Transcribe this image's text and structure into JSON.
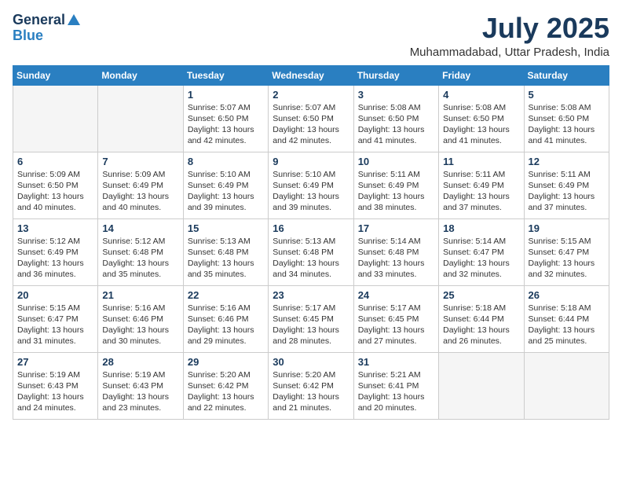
{
  "header": {
    "logo_general": "General",
    "logo_blue": "Blue",
    "month_year": "July 2025",
    "location": "Muhammadabad, Uttar Pradesh, India"
  },
  "days_of_week": [
    "Sunday",
    "Monday",
    "Tuesday",
    "Wednesday",
    "Thursday",
    "Friday",
    "Saturday"
  ],
  "weeks": [
    [
      {
        "day": "",
        "info": ""
      },
      {
        "day": "",
        "info": ""
      },
      {
        "day": "1",
        "info": "Sunrise: 5:07 AM\nSunset: 6:50 PM\nDaylight: 13 hours\nand 42 minutes."
      },
      {
        "day": "2",
        "info": "Sunrise: 5:07 AM\nSunset: 6:50 PM\nDaylight: 13 hours\nand 42 minutes."
      },
      {
        "day": "3",
        "info": "Sunrise: 5:08 AM\nSunset: 6:50 PM\nDaylight: 13 hours\nand 41 minutes."
      },
      {
        "day": "4",
        "info": "Sunrise: 5:08 AM\nSunset: 6:50 PM\nDaylight: 13 hours\nand 41 minutes."
      },
      {
        "day": "5",
        "info": "Sunrise: 5:08 AM\nSunset: 6:50 PM\nDaylight: 13 hours\nand 41 minutes."
      }
    ],
    [
      {
        "day": "6",
        "info": "Sunrise: 5:09 AM\nSunset: 6:50 PM\nDaylight: 13 hours\nand 40 minutes."
      },
      {
        "day": "7",
        "info": "Sunrise: 5:09 AM\nSunset: 6:49 PM\nDaylight: 13 hours\nand 40 minutes."
      },
      {
        "day": "8",
        "info": "Sunrise: 5:10 AM\nSunset: 6:49 PM\nDaylight: 13 hours\nand 39 minutes."
      },
      {
        "day": "9",
        "info": "Sunrise: 5:10 AM\nSunset: 6:49 PM\nDaylight: 13 hours\nand 39 minutes."
      },
      {
        "day": "10",
        "info": "Sunrise: 5:11 AM\nSunset: 6:49 PM\nDaylight: 13 hours\nand 38 minutes."
      },
      {
        "day": "11",
        "info": "Sunrise: 5:11 AM\nSunset: 6:49 PM\nDaylight: 13 hours\nand 37 minutes."
      },
      {
        "day": "12",
        "info": "Sunrise: 5:11 AM\nSunset: 6:49 PM\nDaylight: 13 hours\nand 37 minutes."
      }
    ],
    [
      {
        "day": "13",
        "info": "Sunrise: 5:12 AM\nSunset: 6:49 PM\nDaylight: 13 hours\nand 36 minutes."
      },
      {
        "day": "14",
        "info": "Sunrise: 5:12 AM\nSunset: 6:48 PM\nDaylight: 13 hours\nand 35 minutes."
      },
      {
        "day": "15",
        "info": "Sunrise: 5:13 AM\nSunset: 6:48 PM\nDaylight: 13 hours\nand 35 minutes."
      },
      {
        "day": "16",
        "info": "Sunrise: 5:13 AM\nSunset: 6:48 PM\nDaylight: 13 hours\nand 34 minutes."
      },
      {
        "day": "17",
        "info": "Sunrise: 5:14 AM\nSunset: 6:48 PM\nDaylight: 13 hours\nand 33 minutes."
      },
      {
        "day": "18",
        "info": "Sunrise: 5:14 AM\nSunset: 6:47 PM\nDaylight: 13 hours\nand 32 minutes."
      },
      {
        "day": "19",
        "info": "Sunrise: 5:15 AM\nSunset: 6:47 PM\nDaylight: 13 hours\nand 32 minutes."
      }
    ],
    [
      {
        "day": "20",
        "info": "Sunrise: 5:15 AM\nSunset: 6:47 PM\nDaylight: 13 hours\nand 31 minutes."
      },
      {
        "day": "21",
        "info": "Sunrise: 5:16 AM\nSunset: 6:46 PM\nDaylight: 13 hours\nand 30 minutes."
      },
      {
        "day": "22",
        "info": "Sunrise: 5:16 AM\nSunset: 6:46 PM\nDaylight: 13 hours\nand 29 minutes."
      },
      {
        "day": "23",
        "info": "Sunrise: 5:17 AM\nSunset: 6:45 PM\nDaylight: 13 hours\nand 28 minutes."
      },
      {
        "day": "24",
        "info": "Sunrise: 5:17 AM\nSunset: 6:45 PM\nDaylight: 13 hours\nand 27 minutes."
      },
      {
        "day": "25",
        "info": "Sunrise: 5:18 AM\nSunset: 6:44 PM\nDaylight: 13 hours\nand 26 minutes."
      },
      {
        "day": "26",
        "info": "Sunrise: 5:18 AM\nSunset: 6:44 PM\nDaylight: 13 hours\nand 25 minutes."
      }
    ],
    [
      {
        "day": "27",
        "info": "Sunrise: 5:19 AM\nSunset: 6:43 PM\nDaylight: 13 hours\nand 24 minutes."
      },
      {
        "day": "28",
        "info": "Sunrise: 5:19 AM\nSunset: 6:43 PM\nDaylight: 13 hours\nand 23 minutes."
      },
      {
        "day": "29",
        "info": "Sunrise: 5:20 AM\nSunset: 6:42 PM\nDaylight: 13 hours\nand 22 minutes."
      },
      {
        "day": "30",
        "info": "Sunrise: 5:20 AM\nSunset: 6:42 PM\nDaylight: 13 hours\nand 21 minutes."
      },
      {
        "day": "31",
        "info": "Sunrise: 5:21 AM\nSunset: 6:41 PM\nDaylight: 13 hours\nand 20 minutes."
      },
      {
        "day": "",
        "info": ""
      },
      {
        "day": "",
        "info": ""
      }
    ]
  ]
}
